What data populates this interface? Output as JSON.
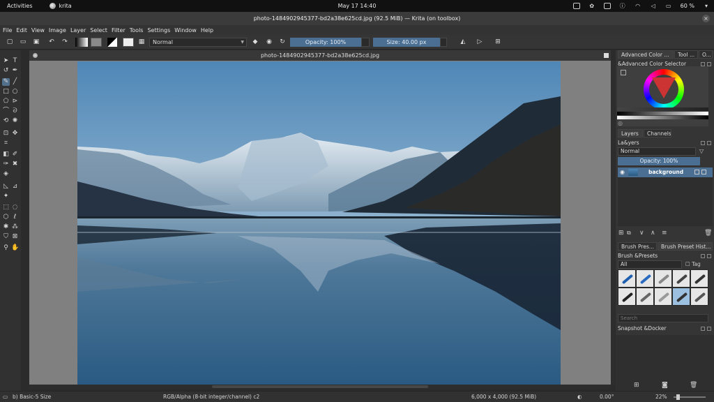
{
  "gnome_bar": {
    "activities": "Activities",
    "app_name": "krita",
    "clock": "May 17  14:40",
    "battery": "60 %"
  },
  "window": {
    "title": "photo-1484902945377-bd2a38e625cd.jpg (92.5 MiB) — Krita (on toolbox)",
    "close_glyph": "×"
  },
  "menu": [
    "File",
    "Edit",
    "View",
    "Image",
    "Layer",
    "Select",
    "Filter",
    "Tools",
    "Settings",
    "Window",
    "Help"
  ],
  "tool_options": {
    "blend_mode": "Normal",
    "opacity": "Opacity: 100%",
    "size": "Size: 40.00 px"
  },
  "canvas": {
    "tab_title": "photo-1484902945377-bd2a38e625cd.jpg"
  },
  "dockers": {
    "top_tabs": [
      "Advanced Color ...",
      "Tool ...",
      "O..."
    ],
    "color_selector_title": "&Advanced Color Selector",
    "layer_tabs": [
      "Layers",
      "Channels"
    ],
    "layers_title": "La&yers",
    "layer_blend_mode": "Normal",
    "layer_opacity": "Opacity:  100%",
    "layers": [
      {
        "name": "background"
      }
    ],
    "brush_tabs": [
      "Brush Pres...",
      "Brush Preset Hist..."
    ],
    "brush_title": "Brush &Presets",
    "brush_filter": "All",
    "brush_tag": "Tag",
    "brush_search_placeholder": "Search",
    "snapshot_title": "Snapshot &Docker"
  },
  "statusbar": {
    "brush": "b) Basic-5 Size",
    "color_model": "RGB/Alpha (8-bit integer/channel)  c2",
    "dimensions": "6,000 x 4,000 (92.5 MiB)",
    "rotation": "0.00°",
    "zoom": "22%"
  },
  "colors": {
    "accent": "#4a6f93",
    "panel": "#353535",
    "canvas_gray": "#808080"
  }
}
